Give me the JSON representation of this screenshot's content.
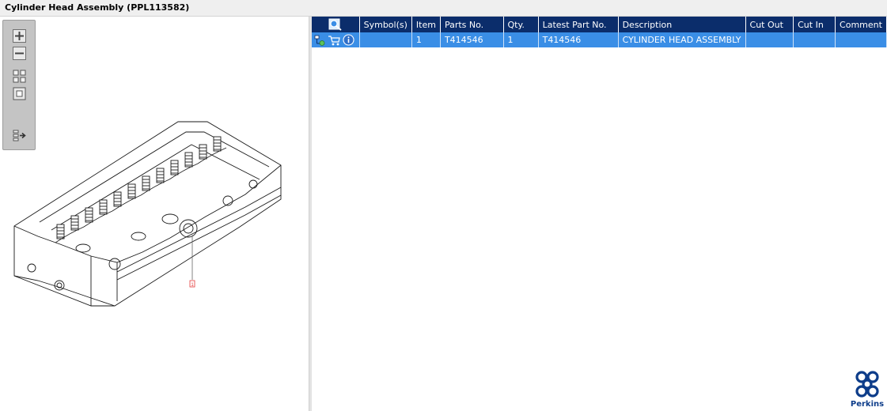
{
  "window": {
    "title": "Cylinder Head Assembly (PPL113582)"
  },
  "toolbar": {
    "buttons": [
      "zoom-in",
      "zoom-out",
      "fit-all",
      "actual-size",
      "export"
    ]
  },
  "drawing": {
    "callout_label": "1",
    "callout_color": "#e33b3b"
  },
  "table": {
    "columns": [
      "Symbol(s)",
      "Item",
      "Parts No.",
      "Qty.",
      "Latest Part No.",
      "Description",
      "Cut Out",
      "Cut In",
      "Comment"
    ],
    "header_icon": "search-list-icon",
    "rows": [
      {
        "icons": [
          "tree-icon",
          "cart-icon",
          "info-icon"
        ],
        "symbols": "",
        "item": "1",
        "parts_no": "T414546",
        "qty": "1",
        "latest_part_no": "T414546",
        "description": "CYLINDER HEAD ASSEMBLY",
        "cut_out": "",
        "cut_in": "",
        "comment": ""
      }
    ]
  },
  "colors": {
    "header_bg": "#0b2d6b",
    "selected_row_bg": "#3a8ee6",
    "brand": "#0e3d8a"
  },
  "brand": {
    "name": "Perkins"
  }
}
